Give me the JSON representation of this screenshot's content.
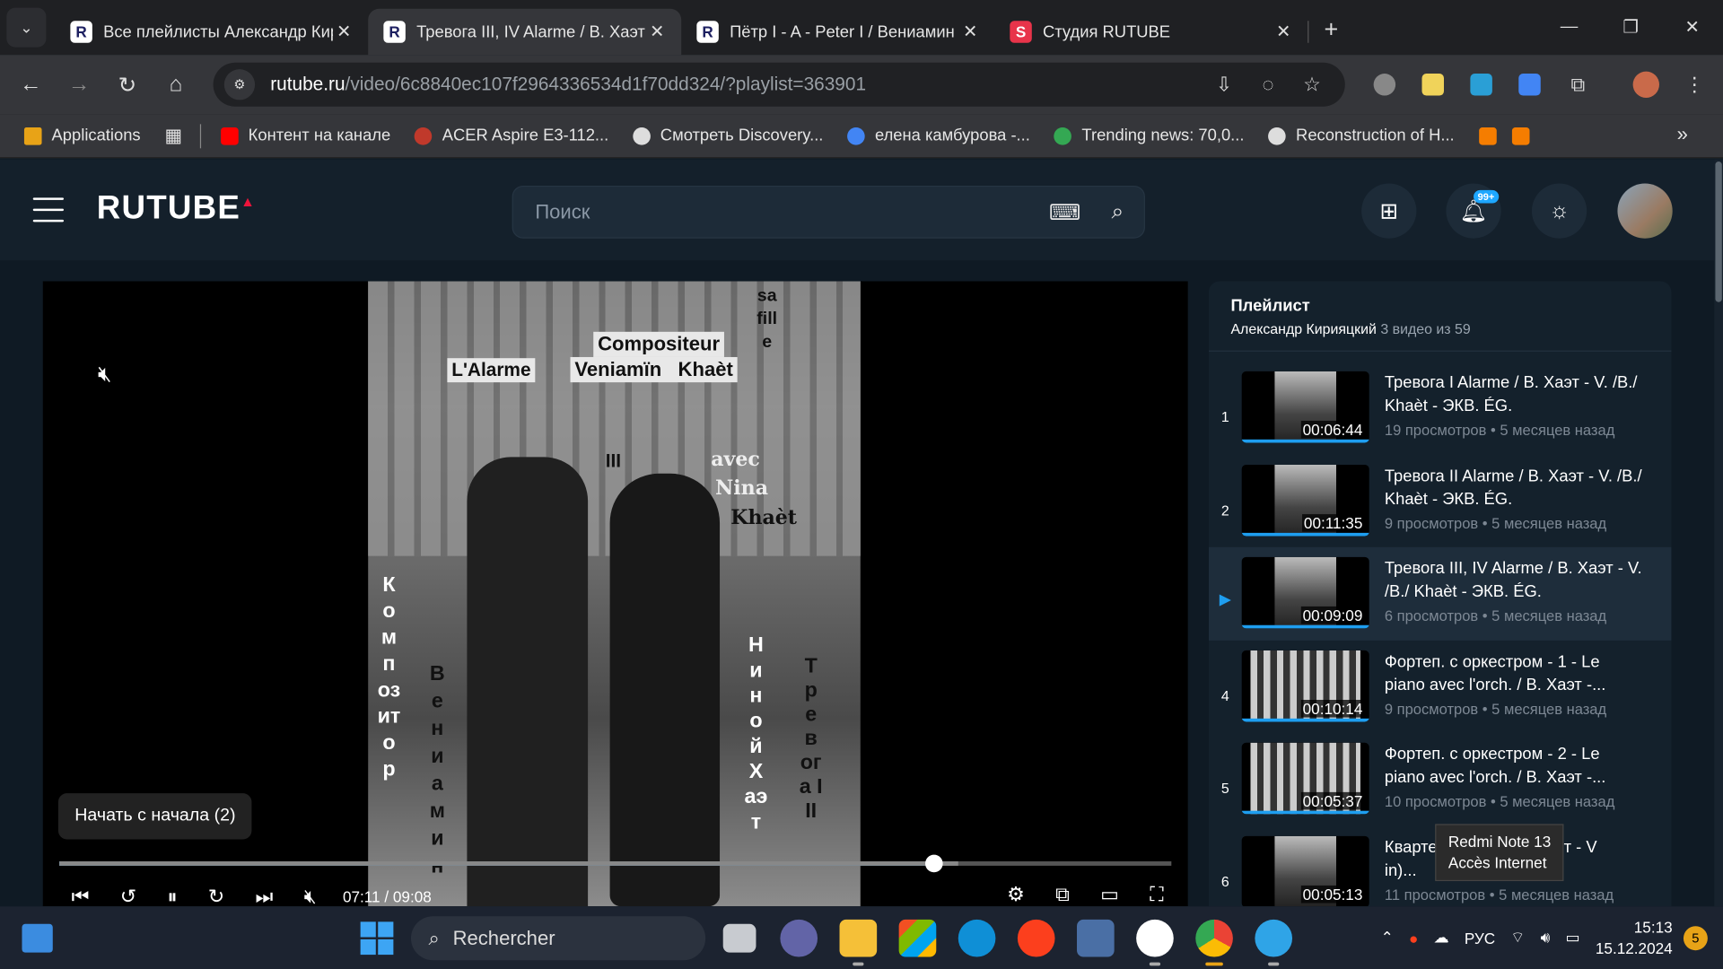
{
  "browser": {
    "tabs": [
      {
        "title": "Все плейлисты Александр Кир",
        "icon": "R",
        "active": false
      },
      {
        "title": "Тревога III, IV Alarme / В. Хаэт",
        "icon": "R",
        "active": true
      },
      {
        "title": "Пётр I - A - Peter I / Вениамин",
        "icon": "R",
        "active": false
      },
      {
        "title": "Студия RUTUBE",
        "icon": "S",
        "active": false
      }
    ],
    "url_host": "rutube.ru",
    "url_path": "/video/6c8840ec107f2964336534d1f70dd324/?playlist=363901",
    "bookmarks": [
      {
        "label": "Applications",
        "color": "#e8a317"
      },
      {
        "label": "Контент на канале",
        "color": "#ff0000"
      },
      {
        "label": "ACER Aspire E3-112...",
        "color": "#c0392b"
      },
      {
        "label": "Смотреть Discovery...",
        "color": "#dddddd"
      },
      {
        "label": "елена камбурова -...",
        "color": "#4285f4"
      },
      {
        "label": "Trending news: 70,0...",
        "color": "#34a853"
      },
      {
        "label": "Reconstruction of H...",
        "color": "#dddddd"
      }
    ]
  },
  "site": {
    "logo": "RUTUBE",
    "search_placeholder": "Поиск",
    "notif_badge": "99+"
  },
  "player": {
    "restart_label": "Начать с начала (2)",
    "time": "07:11 / 09:08",
    "progress": 0.787,
    "buffered": 0.808,
    "video_texts": {
      "alarme": "L'Alarme",
      "compositeur": "Compositeur",
      "name": "Veniamïn   Khaèt",
      "roman": "III",
      "avec": "avec",
      "nina": "Nina",
      "khaet": "Khaèt",
      "safille": "safille",
      "col1": "Композитор",
      "col2": "Вениамин",
      "col3": "Ниной Хаэт",
      "col4": "Тревога III"
    }
  },
  "playlist": {
    "title": "Плейлист",
    "author": "Александр Кирияцкий",
    "count": "3 видео из 59",
    "items": [
      {
        "num": "1",
        "title": "Тревога I Alarme / В. Хаэт - V. /B./ Khaèt - ЭКВ. ÉG.",
        "duration": "00:06:44",
        "views": "19 просмотров",
        "ago": "5 месяцев назад",
        "watched": 1.0
      },
      {
        "num": "2",
        "title": "Тревога II Alarme / В. Хаэт - V. /B./ Khaèt - ЭКВ. ÉG.",
        "duration": "00:11:35",
        "views": "9 просмотров",
        "ago": "5 месяцев назад",
        "watched": 1.0
      },
      {
        "num": "3",
        "title": "Тревога III, IV Alarme / В. Хаэт - V. /B./ Khaèt - ЭКВ. ÉG.",
        "duration": "00:09:09",
        "views": "6 просмотров",
        "ago": "5 месяцев назад",
        "watched": 1.0,
        "active": true
      },
      {
        "num": "4",
        "title": "Фортеп. с оркестром - 1 - Le piano avec l'orch. / В. Хаэт -...",
        "duration": "00:10:14",
        "views": "9 просмотров",
        "ago": "5 месяцев назад",
        "watched": 1.0
      },
      {
        "num": "5",
        "title": "Фортеп. с оркестром - 2 - Le piano avec l'orch. / В. Хаэт -...",
        "duration": "00:05:37",
        "views": "10 просмотров",
        "ago": "5 месяцев назад",
        "watched": 1.0
      },
      {
        "num": "6",
        "title": "Кварте          иамин Хаэт - V          in)...",
        "duration": "00:05:13",
        "views": "11 просмотров",
        "ago": "5 месяцев назад",
        "watched": 0.0
      }
    ],
    "tooltip_line1": "Redmi Note 13",
    "tooltip_line2": "Accès Internet"
  },
  "taskbar": {
    "search_label": "Rechercher",
    "lang": "РУС",
    "time": "15:13",
    "date": "15.12.2024",
    "notif_count": "5"
  }
}
